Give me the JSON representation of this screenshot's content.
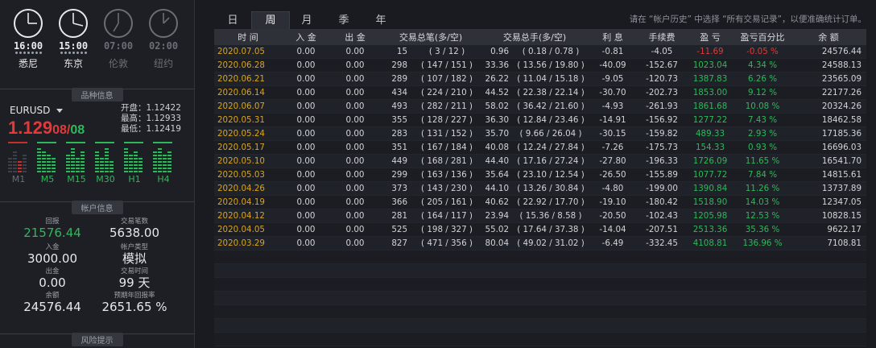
{
  "clocks": [
    {
      "time": "16:00",
      "city": "悉尼",
      "active": true
    },
    {
      "time": "15:00",
      "city": "东京",
      "active": true
    },
    {
      "time": "07:00",
      "city": "伦敦",
      "active": false
    },
    {
      "time": "02:00",
      "city": "纽约",
      "active": false
    }
  ],
  "sections": {
    "symbol_info": "品种信息",
    "account_info": "帐户信息",
    "risk_tips": "风险提示"
  },
  "symbol": {
    "name": "EURUSD",
    "price_main": "1.129",
    "price_small_a": "08",
    "price_sep": "/",
    "price_small_b": "08",
    "open_label": "开盘：",
    "open": "1.12422",
    "high_label": "最高：",
    "high": "1.12933",
    "low_label": "最低：",
    "low": "1.12419",
    "timeframes": [
      "M1",
      "M5",
      "M15",
      "M30",
      "H1",
      "H4"
    ]
  },
  "account": {
    "return_label": "回报",
    "return": "21576.44",
    "trades_label": "交易笔数",
    "trades": "5638.00",
    "deposit_label": "入金",
    "deposit": "3000.00",
    "type_label": "帐户类型",
    "type": "模拟",
    "withdraw_label": "出金",
    "withdraw": "0.00",
    "time_label": "交易时间",
    "time": "99 天",
    "balance_label": "余额",
    "balance": "24576.44",
    "annual_label": "预期年回报率",
    "annual": "2651.65 %"
  },
  "tabs": [
    "日",
    "周",
    "月",
    "季",
    "年"
  ],
  "active_tab": 1,
  "hint": "请在 “帐户历史” 中选择 “所有交易记录”，以便准确统计订单。",
  "table": {
    "headers": [
      "时 间",
      "入 金",
      "出 金",
      "交易总笔(多/空)",
      "交易总手(多/空)",
      "利 息",
      "手续费",
      "盈 亏",
      "盈亏百分比",
      "余 额"
    ],
    "rows": [
      [
        "2020.07.05",
        "0.00",
        "0.00",
        "15",
        "( 3 / 12 )",
        "0.96",
        "( 0.18 / 0.78 )",
        "-0.81",
        "-4.05",
        "-11.69",
        "-0.05 %",
        "24576.44"
      ],
      [
        "2020.06.28",
        "0.00",
        "0.00",
        "298",
        "( 147 / 151 )",
        "33.36",
        "( 13.56 / 19.80 )",
        "-40.09",
        "-152.67",
        "1023.04",
        "4.34 %",
        "24588.13"
      ],
      [
        "2020.06.21",
        "0.00",
        "0.00",
        "289",
        "( 107 / 182 )",
        "26.22",
        "( 11.04 / 15.18 )",
        "-9.05",
        "-120.73",
        "1387.83",
        "6.26 %",
        "23565.09"
      ],
      [
        "2020.06.14",
        "0.00",
        "0.00",
        "434",
        "( 224 / 210 )",
        "44.52",
        "( 22.38 / 22.14 )",
        "-30.70",
        "-202.73",
        "1853.00",
        "9.12 %",
        "22177.26"
      ],
      [
        "2020.06.07",
        "0.00",
        "0.00",
        "493",
        "( 282 / 211 )",
        "58.02",
        "( 36.42 / 21.60 )",
        "-4.93",
        "-261.93",
        "1861.68",
        "10.08 %",
        "20324.26"
      ],
      [
        "2020.05.31",
        "0.00",
        "0.00",
        "355",
        "( 128 / 227 )",
        "36.30",
        "( 12.84 / 23.46 )",
        "-14.91",
        "-156.92",
        "1277.22",
        "7.43 %",
        "18462.58"
      ],
      [
        "2020.05.24",
        "0.00",
        "0.00",
        "283",
        "( 131 / 152 )",
        "35.70",
        "( 9.66 / 26.04 )",
        "-30.15",
        "-159.82",
        "489.33",
        "2.93 %",
        "17185.36"
      ],
      [
        "2020.05.17",
        "0.00",
        "0.00",
        "351",
        "( 167 / 184 )",
        "40.08",
        "( 12.24 / 27.84 )",
        "-7.26",
        "-175.73",
        "154.33",
        "0.93 %",
        "16696.03"
      ],
      [
        "2020.05.10",
        "0.00",
        "0.00",
        "449",
        "( 168 / 281 )",
        "44.40",
        "( 17.16 / 27.24 )",
        "-27.80",
        "-196.33",
        "1726.09",
        "11.65 %",
        "16541.70"
      ],
      [
        "2020.05.03",
        "0.00",
        "0.00",
        "299",
        "( 163 / 136 )",
        "35.64",
        "( 23.10 / 12.54 )",
        "-26.50",
        "-155.89",
        "1077.72",
        "7.84 %",
        "14815.61"
      ],
      [
        "2020.04.26",
        "0.00",
        "0.00",
        "373",
        "( 143 / 230 )",
        "44.10",
        "( 13.26 / 30.84 )",
        "-4.80",
        "-199.00",
        "1390.84",
        "11.26 %",
        "13737.89"
      ],
      [
        "2020.04.19",
        "0.00",
        "0.00",
        "366",
        "( 205 / 161 )",
        "40.62",
        "( 22.92 / 17.70 )",
        "-19.10",
        "-180.42",
        "1518.90",
        "14.03 %",
        "12347.05"
      ],
      [
        "2020.04.12",
        "0.00",
        "0.00",
        "281",
        "( 164 / 117 )",
        "23.94",
        "( 15.36 / 8.58 )",
        "-20.50",
        "-102.43",
        "1205.98",
        "12.53 %",
        "10828.15"
      ],
      [
        "2020.04.05",
        "0.00",
        "0.00",
        "525",
        "( 198 / 327 )",
        "55.02",
        "( 17.64 / 37.38 )",
        "-14.04",
        "-207.51",
        "2513.36",
        "35.36 %",
        "9622.17"
      ],
      [
        "2020.03.29",
        "0.00",
        "0.00",
        "827",
        "( 471 / 356 )",
        "80.04",
        "( 49.02 / 31.02 )",
        "-6.49",
        "-332.45",
        "4108.81",
        "136.96 %",
        "7108.81"
      ]
    ]
  },
  "colors": {
    "up": "#2fb85a",
    "down": "#e23a3a",
    "date": "#d9a420"
  }
}
